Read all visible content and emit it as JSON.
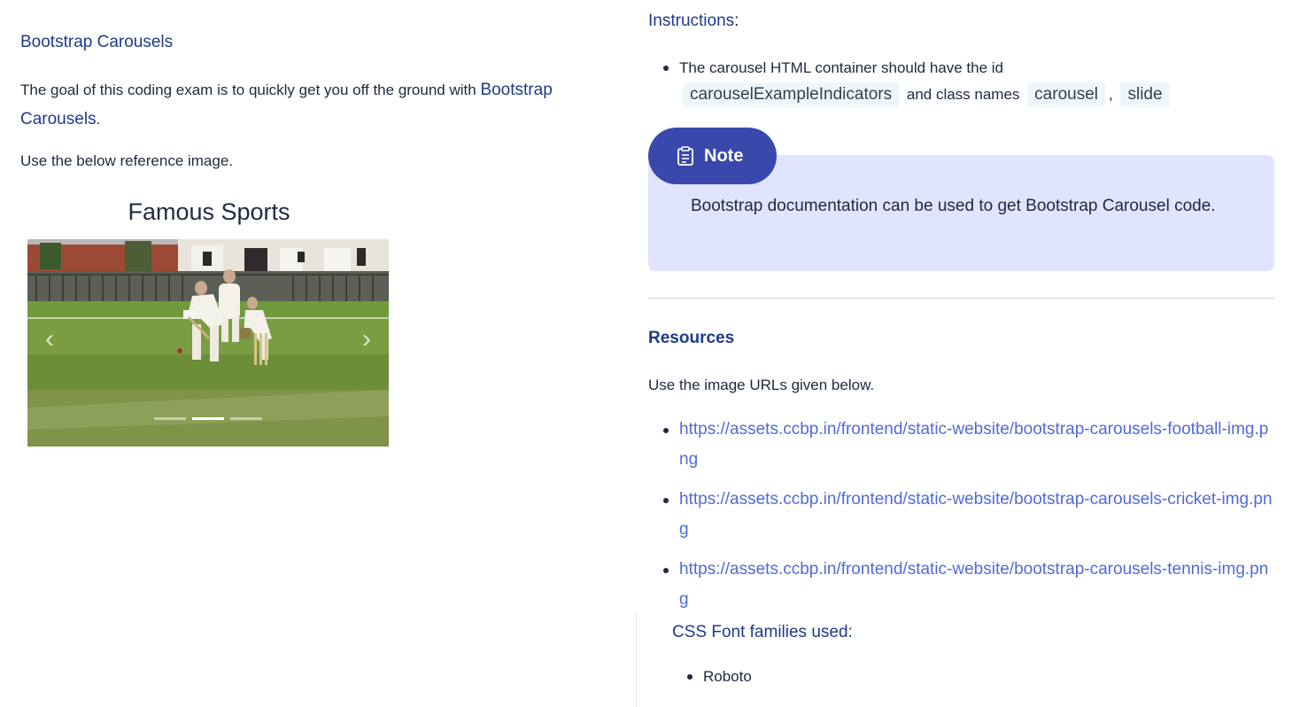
{
  "left": {
    "title": "Bootstrap Carousels",
    "intro_text": "The goal of this coding exam is to quickly get you off the ground with ",
    "intro_link": "Bootstrap Carousels",
    "intro_end": ".",
    "use_reference": "Use the below reference image.",
    "reference": {
      "heading": "Famous Sports",
      "prev_icon": "‹",
      "next_icon": "›",
      "indicator_count": 3,
      "active_index": 1
    }
  },
  "right": {
    "instructions_heading": "Instructions",
    "instructions_colon": ":",
    "instruction_items": [
      {
        "text": "The carousel HTML container should have the id",
        "code_id": "carouselExampleIndicators",
        "mid": "and class names",
        "code_class1": "carousel",
        "sep": ",",
        "code_class2": "slide"
      }
    ],
    "note": {
      "label": "Note",
      "icon": "clipboard-icon",
      "text": "Bootstrap documentation can be used to get Bootstrap Carousel code."
    },
    "resources_heading": "Resources",
    "resources_text": "Use the image URLs given below.",
    "resource_links": [
      "https://assets.ccbp.in/frontend/static-website/bootstrap-carousels-football-img.png",
      "https://assets.ccbp.in/frontend/static-website/bootstrap-carousels-cricket-img.png",
      "https://assets.ccbp.in/frontend/static-website/bootstrap-carousels-tennis-img.png"
    ],
    "fonts_heading": "CSS Font families used:",
    "fonts": [
      "Roboto"
    ]
  },
  "colors": {
    "heading": "#1e3a8a",
    "link": "#4f6bd8",
    "note_bg": "#e0e4ff",
    "note_tag": "#3949ab",
    "code_bg": "#eef6fb"
  }
}
